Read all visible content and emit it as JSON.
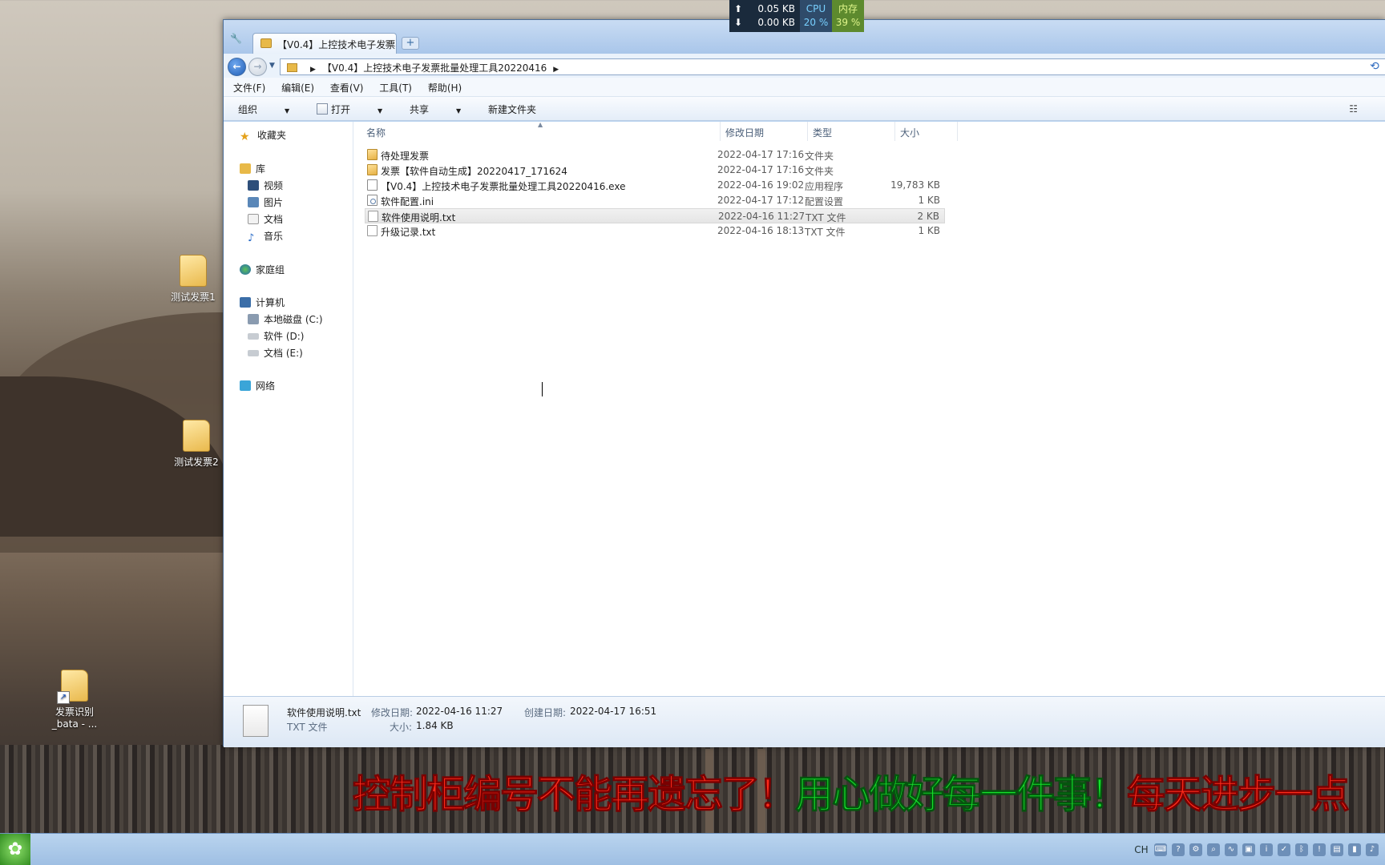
{
  "desktop": {
    "icons": [
      {
        "label": "测试发票1"
      },
      {
        "label": "测试发票2"
      },
      {
        "label": "发票识别",
        "label2": "_bata - ..."
      }
    ]
  },
  "network_monitor": {
    "upload": "0.05 KB",
    "download": "0.00 KB",
    "cpu_label": "CPU",
    "cpu_value": "20 %",
    "mem_label": "内存",
    "mem_value": "39 %"
  },
  "window": {
    "tab_title": "【V0.4】上控技术电子发票",
    "address_path": "【V0.4】上控技术电子发票批量处理工具20220416",
    "menu": [
      "文件(F)",
      "编辑(E)",
      "查看(V)",
      "工具(T)",
      "帮助(H)"
    ],
    "toolbar": {
      "organize": "组织",
      "open": "打开",
      "share": "共享",
      "new_folder": "新建文件夹"
    },
    "nav": {
      "favorites": "收藏夹",
      "libraries": "库",
      "lib_items": [
        "视频",
        "图片",
        "文档",
        "音乐"
      ],
      "homegroup": "家庭组",
      "computer": "计算机",
      "drives": [
        "本地磁盘 (C:)",
        "软件 (D:)",
        "文档 (E:)"
      ],
      "network": "网络"
    },
    "columns": {
      "name": "名称",
      "date": "修改日期",
      "type": "类型",
      "size": "大小"
    },
    "files": [
      {
        "name": "待处理发票",
        "date": "2022-04-17 17:16",
        "type": "文件夹",
        "size": "",
        "icon": "folder-icon"
      },
      {
        "name": "发票【软件自动生成】20220417_171624",
        "date": "2022-04-17 17:16",
        "type": "文件夹",
        "size": "",
        "icon": "folder-icon"
      },
      {
        "name": "【V0.4】上控技术电子发票批量处理工具20220416.exe",
        "date": "2022-04-16 19:02",
        "type": "应用程序",
        "size": "19,783 KB",
        "icon": "exe-icon"
      },
      {
        "name": "软件配置.ini",
        "date": "2022-04-17 17:12",
        "type": "配置设置",
        "size": "1 KB",
        "icon": "ini-icon"
      },
      {
        "name": "软件使用说明.txt",
        "date": "2022-04-16 11:27",
        "type": "TXT 文件",
        "size": "2 KB",
        "icon": "txt-icon"
      },
      {
        "name": "升级记录.txt",
        "date": "2022-04-16 18:13",
        "type": "TXT 文件",
        "size": "1 KB",
        "icon": "txt-icon"
      }
    ],
    "selected_index": 4,
    "details": {
      "filename": "软件使用说明.txt",
      "filetype": "TXT 文件",
      "modified_label": "修改日期:",
      "modified": "2022-04-16 11:27",
      "created_label": "创建日期:",
      "created": "2022-04-17 16:51",
      "size_label": "大小:",
      "size": "1.84 KB"
    }
  },
  "banner": {
    "part1": "控制柜编号不能再遗忘了！",
    "part2": "用心做好每一件事！",
    "part3": "每天进步一点"
  },
  "taskbar": {
    "tray_lang": "CH"
  }
}
